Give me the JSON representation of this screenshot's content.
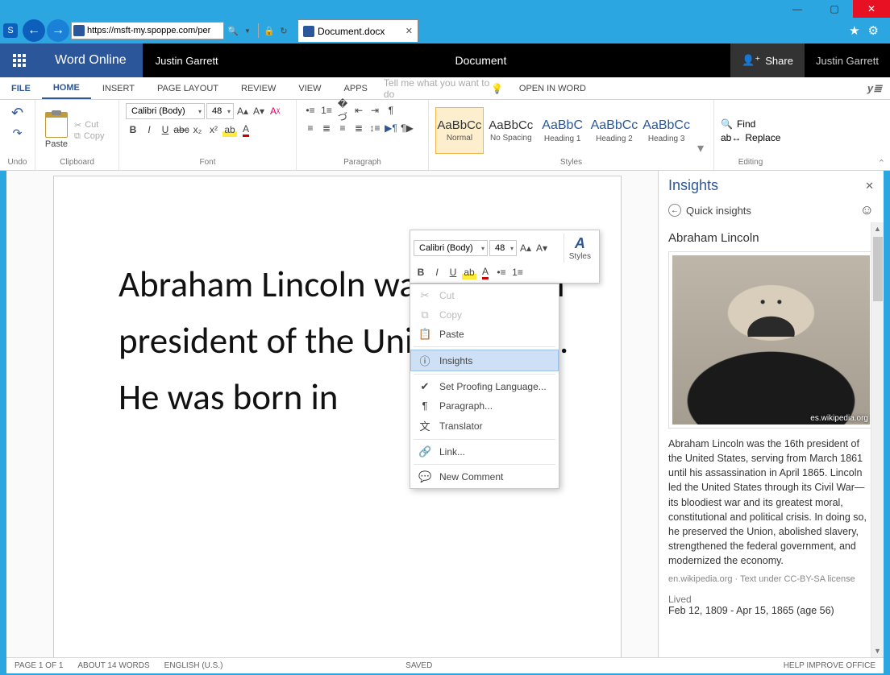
{
  "window": {
    "minimize": "—",
    "maximize": "▢",
    "close": "✕"
  },
  "ie": {
    "url": "https://msft-my.spoppe.com/per",
    "tab_title": "Document.docx",
    "search_glyph": "🔍",
    "lock_glyph": "🔒",
    "refresh_glyph": "↻",
    "star_glyph": "★",
    "gear_glyph": "⚙"
  },
  "header": {
    "app": "Word Online",
    "user_left": "Justin Garrett",
    "doc_title": "Document",
    "share": "Share",
    "user_right": "Justin Garrett"
  },
  "tabs": {
    "file": "FILE",
    "home": "HOME",
    "insert": "INSERT",
    "page_layout": "PAGE LAYOUT",
    "review": "REVIEW",
    "view": "VIEW",
    "apps": "APPS",
    "tell_me": "Tell me what you want to do",
    "open_in_word": "OPEN IN WORD",
    "yammer": "y≣"
  },
  "ribbon": {
    "undo": "Undo",
    "clipboard": "Clipboard",
    "paste": "Paste",
    "cut": "Cut",
    "copy": "Copy",
    "font_group": "Font",
    "font_name": "Calibri (Body)",
    "font_size": "48",
    "paragraph": "Paragraph",
    "styles_label": "Styles",
    "styles": [
      {
        "label": "Normal",
        "sample": "AaBbCc"
      },
      {
        "label": "No Spacing",
        "sample": "AaBbCc"
      },
      {
        "label": "Heading 1",
        "sample": "AaBbC"
      },
      {
        "label": "Heading 2",
        "sample": "AaBbCc"
      },
      {
        "label": "Heading 3",
        "sample": "AaBbCc"
      }
    ],
    "editing": "Editing",
    "find": "Find",
    "replace": "Replace"
  },
  "mini": {
    "font_name": "Calibri (Body)",
    "font_size": "48",
    "styles_label": "Styles"
  },
  "ctx": {
    "cut": "Cut",
    "copy": "Copy",
    "paste": "Paste",
    "insights": "Insights",
    "proofing": "Set Proofing Language...",
    "paragraph": "Paragraph...",
    "translator": "Translator",
    "link": "Link...",
    "comment": "New Comment"
  },
  "document": {
    "text": "Abraham Lincoln was the 16th president of the United States. He was born in"
  },
  "insights": {
    "title": "Insights",
    "quick": "Quick insights",
    "subject": "Abraham Lincoln",
    "image_attr": "es.wikipedia.org",
    "desc": "Abraham Lincoln was the 16th president of the United States, serving from March 1861 until his assassination in April 1865. Lincoln led the United States through its Civil War—its bloodiest war and its greatest moral, constitutional and political crisis. In doing so, he preserved the Union, abolished slavery, strengthened the federal government, and modernized the economy.",
    "source": "en.wikipedia.org · Text under CC-BY-SA license",
    "lived_label": "Lived",
    "lived_value": "Feb 12, 1809 - Apr 15, 1865 (age 56)"
  },
  "status": {
    "page": "PAGE 1 OF 1",
    "words": "ABOUT 14 WORDS",
    "lang": "ENGLISH (U.S.)",
    "saved": "SAVED",
    "help": "HELP IMPROVE OFFICE"
  }
}
